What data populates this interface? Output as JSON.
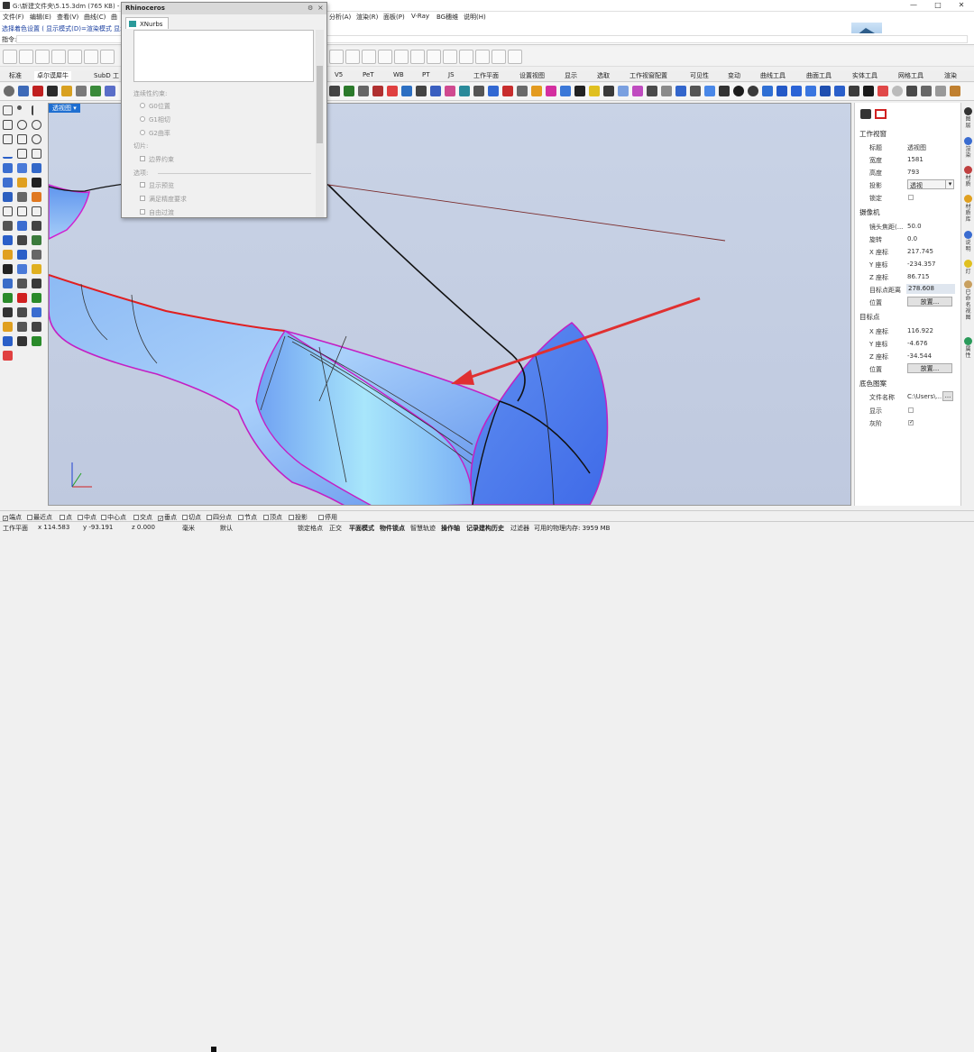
{
  "window": {
    "title": "G:\\新建文件夹\\5.15.3dm (765 KB) - Rh",
    "buttons": [
      "—",
      "□",
      "✕"
    ]
  },
  "menu": [
    "文件(F)",
    "编辑(E)",
    "查看(V)",
    "曲线(C)",
    "曲",
    "分析(A)",
    "渲染(R)",
    "面板(P)",
    "V-Ray",
    "BG穗维",
    "说明(H)"
  ],
  "command": {
    "history": "选择着色设置 ( 显示模式(D)=渲染模式  显示",
    "prompt_label": "指令:"
  },
  "tabs": [
    "标准",
    "卓尔谟犀牛",
    "SubD 工",
    "V5",
    "PeT",
    "WB",
    "PT",
    "JS",
    "工作平面",
    "设置视图",
    "显示",
    "选取",
    "工作视窗配置",
    "可见性",
    "变动",
    "曲线工具",
    "曲面工具",
    "实体工具",
    "网格工具",
    "渲染"
  ],
  "viewport": {
    "label": "透视图"
  },
  "dialog": {
    "title": "Rhinoceros",
    "tab": "XNurbs",
    "continuity_label": "连续性约束:",
    "options": [
      "G0位置",
      "G1相切",
      "G2曲率"
    ],
    "tangent_label": "切片:",
    "edge_option": "边界约束",
    "options_label": "选项:",
    "checks": [
      "显示预览",
      "满足精度要求",
      "自由过渡"
    ]
  },
  "panel": {
    "viewport_section": "工作视窗",
    "title_key": "标题",
    "title_val": "透视图",
    "width_key": "宽度",
    "width_val": "1581",
    "height_key": "高度",
    "height_val": "793",
    "projection_key": "投影",
    "projection_val": "透视",
    "lock_key": "锁定",
    "camera_section": "摄像机",
    "lens_key": "镜头焦距(...",
    "lens_val": "50.0",
    "rotation_key": "旋转",
    "rotation_val": "0.0",
    "cx_key": "X 座标",
    "cx_val": "217.745",
    "cy_key": "Y 座标",
    "cy_val": "-234.357",
    "cz_key": "Z 座标",
    "cz_val": "86.715",
    "dist_key": "目标点距离",
    "dist_val": "278.608",
    "pos_key": "位置",
    "place_btn": "放置...",
    "target_section": "目标点",
    "tx_key": "X 座标",
    "tx_val": "116.922",
    "ty_key": "Y 座标",
    "ty_val": "-4.676",
    "tz_key": "Z 座标",
    "tz_val": "-34.544",
    "tpos_key": "位置",
    "tplace_btn": "放置...",
    "bg_section": "底色图案",
    "file_key": "文件名称",
    "file_val": "C:\\Users\\...",
    "file_btn": "...",
    "show_key": "显示",
    "gray_key": "灰阶"
  },
  "side_tabs": [
    "图层",
    "渲染",
    "材质",
    "材质库",
    "说明",
    "灯",
    "已命名视图",
    "属性"
  ],
  "osnap": [
    "端点",
    "最近点",
    "点",
    "中点",
    "中心点",
    "交点",
    "垂点",
    "切点",
    "四分点",
    "节点",
    "顶点",
    "投影",
    "停用"
  ],
  "osnap_checked": [
    true,
    false,
    false,
    false,
    false,
    false,
    true,
    false,
    false,
    false,
    false,
    false,
    false
  ],
  "status": {
    "cplane": "工作平面",
    "x": "x 114.583",
    "y": "y -93.191",
    "z": "z 0.000",
    "unit": "毫米",
    "layer": "默认",
    "items": [
      "锁定格点",
      "正交",
      "平面模式",
      "物件锁点",
      "智慧轨迹",
      "操作轴",
      "记录建构历史",
      "过滤器",
      "可用的物理内存: 3959 MB"
    ]
  },
  "colors": {
    "surface": "#7fb2f5",
    "surface_dark": "#4a7ff0",
    "edge_magenta": "#d020d0",
    "edge_red": "#e02020",
    "arrow": "#e03030",
    "vp_label": "#1f6fd1"
  }
}
